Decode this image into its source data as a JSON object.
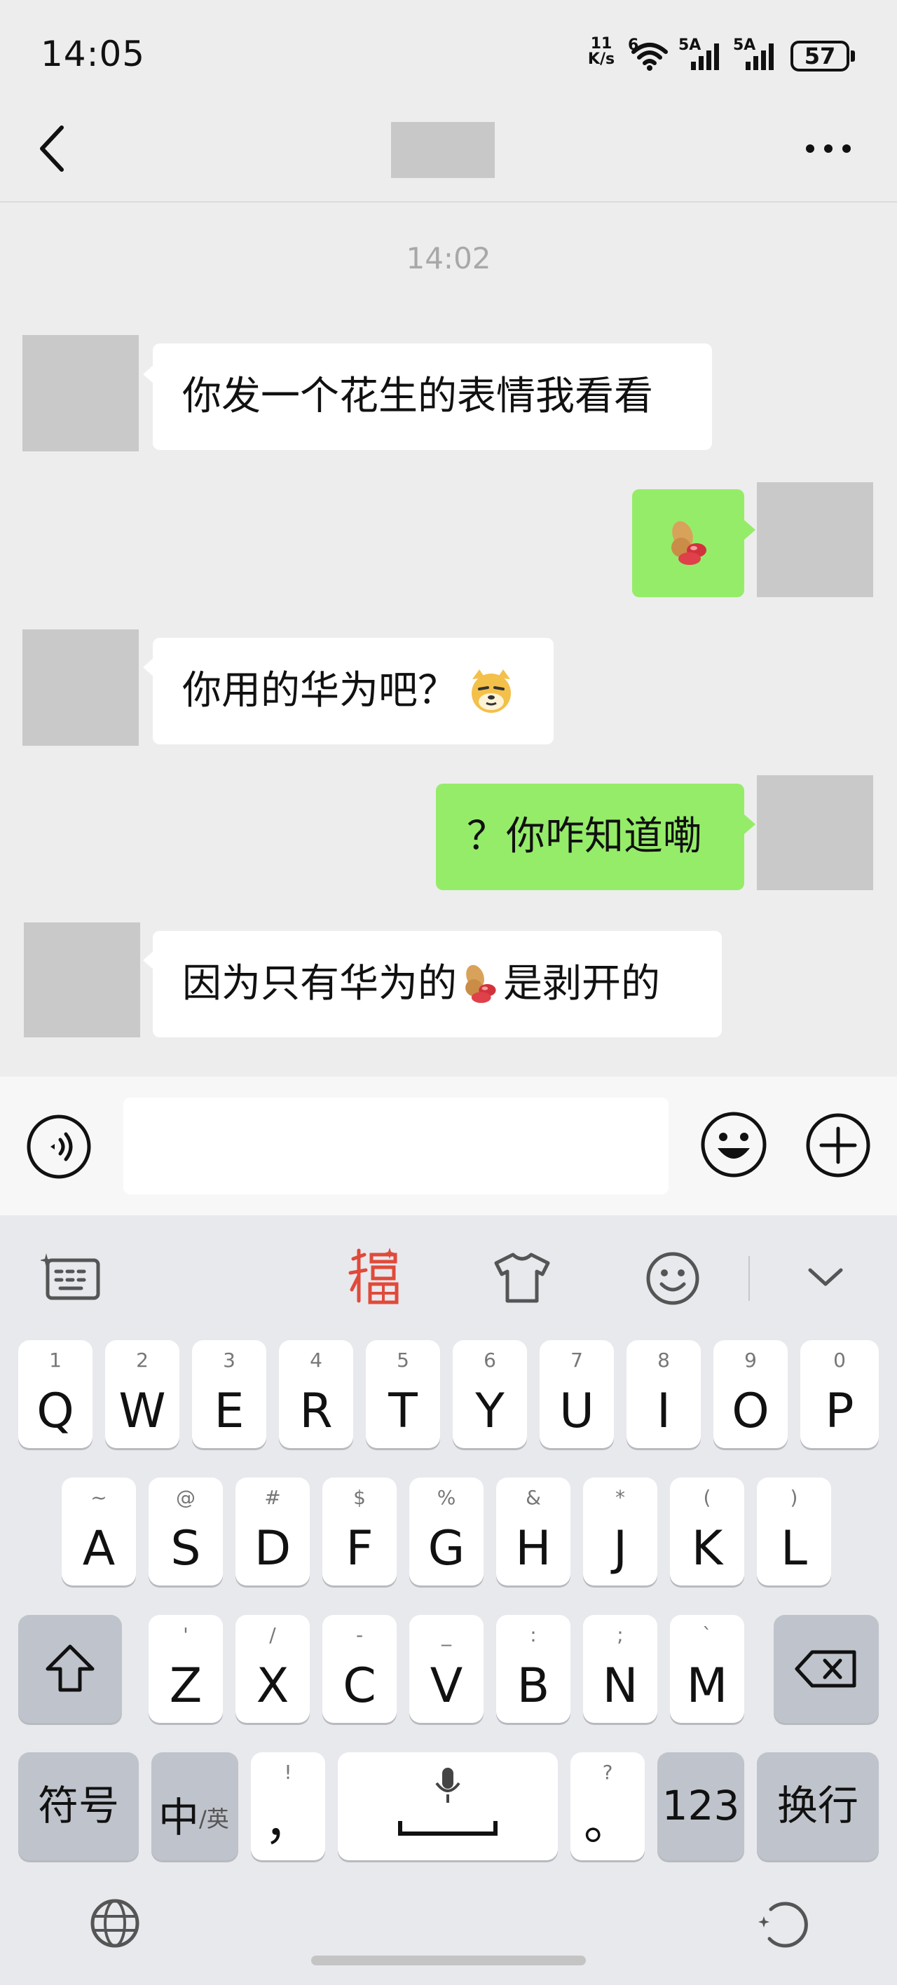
{
  "status_bar": {
    "time": "14:05",
    "net_speed_value": "11",
    "net_speed_unit": "K/s",
    "wifi_label": "6",
    "signal_1_label": "5A",
    "signal_2_label": "5A",
    "battery": "57"
  },
  "nav": {
    "back_icon": "chevron-left-icon",
    "more_icon": "more-horizontal-icon"
  },
  "chat": {
    "timestamp": "14:02",
    "messages": [
      {
        "side": "incoming",
        "text": "你发一个花生的表情我看看"
      },
      {
        "side": "outgoing",
        "emoji": "peanut"
      },
      {
        "side": "incoming",
        "text": "你用的华为吧？",
        "emoji": "doge-cat"
      },
      {
        "side": "outgoing",
        "text": "？你咋知道嘞"
      },
      {
        "side": "incoming",
        "text_before": "因为只有华为的",
        "emoji": "peanut",
        "text_after": "是剥开的"
      }
    ]
  },
  "input_bar": {
    "voice_icon": "voice-icon",
    "input_value": "",
    "emoji_icon": "smiley-icon",
    "plus_icon": "plus-circle-icon"
  },
  "keyboard": {
    "toolbar_icons": [
      "keyboard-settings-icon",
      "fu-icon",
      "shirt-icon",
      "smiley-icon",
      "chevron-down-icon"
    ],
    "row1": [
      {
        "main": "Q",
        "sub": "1"
      },
      {
        "main": "W",
        "sub": "2"
      },
      {
        "main": "E",
        "sub": "3"
      },
      {
        "main": "R",
        "sub": "4"
      },
      {
        "main": "T",
        "sub": "5"
      },
      {
        "main": "Y",
        "sub": "6"
      },
      {
        "main": "U",
        "sub": "7"
      },
      {
        "main": "I",
        "sub": "8"
      },
      {
        "main": "O",
        "sub": "9"
      },
      {
        "main": "P",
        "sub": "0"
      }
    ],
    "row2": [
      {
        "main": "A",
        "sub": "~"
      },
      {
        "main": "S",
        "sub": "@"
      },
      {
        "main": "D",
        "sub": "#"
      },
      {
        "main": "F",
        "sub": "$"
      },
      {
        "main": "G",
        "sub": "%"
      },
      {
        "main": "H",
        "sub": "&"
      },
      {
        "main": "J",
        "sub": "*"
      },
      {
        "main": "K",
        "sub": "("
      },
      {
        "main": "L",
        "sub": ")"
      }
    ],
    "row3": [
      {
        "main": "Z",
        "sub": "'"
      },
      {
        "main": "X",
        "sub": "/"
      },
      {
        "main": "C",
        "sub": "-"
      },
      {
        "main": "V",
        "sub": "_"
      },
      {
        "main": "B",
        "sub": ":"
      },
      {
        "main": "N",
        "sub": ";"
      },
      {
        "main": "M",
        "sub": "`"
      }
    ],
    "symbols_label": "符号",
    "lang_main": "中",
    "lang_sub": "/英",
    "comma_main": "，",
    "comma_sub": "!",
    "period_main": "。",
    "period_sub": "?",
    "numbers_label": "123",
    "enter_label": "换行",
    "shift_icon": "shift-icon",
    "delete_icon": "backspace-icon",
    "space_icon": "microphone-icon",
    "globe_icon": "globe-icon",
    "assist_icon": "sparkle-refresh-icon"
  },
  "colors": {
    "outgoing_bubble": "#95ec69",
    "incoming_bubble": "#ffffff",
    "background": "#ededed",
    "keyboard_bg": "#e8e9ed"
  }
}
